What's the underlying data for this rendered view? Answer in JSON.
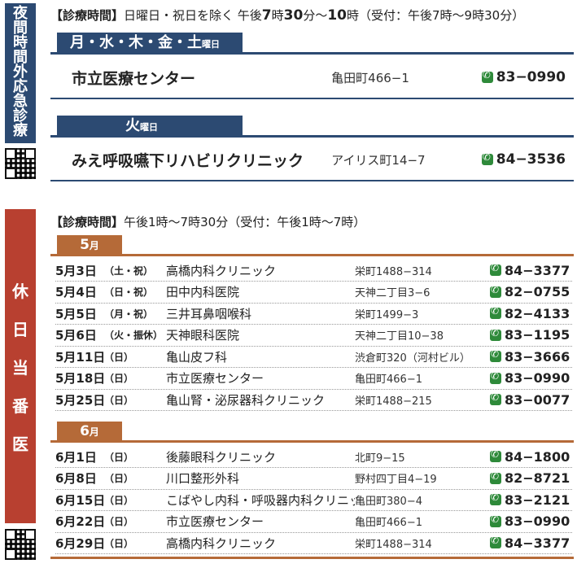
{
  "night": {
    "side_label": [
      "夜",
      "間",
      "時",
      "間",
      "外",
      "応",
      "急",
      "診",
      "療"
    ],
    "hours_label": "【診療時間】",
    "hours_text": "日曜日・祝日を除く 午後",
    "hours_big1": "7",
    "hours_text2": "時",
    "hours_big2": "30",
    "hours_text3": "分～",
    "hours_big3": "10",
    "hours_text4": "時（受付：午後7時～9時30分）",
    "groups": [
      {
        "days": "月・水・木・金・土",
        "suffix": "曜日",
        "clinic": {
          "name": "市立医療センター",
          "address": "亀田町466−1",
          "tel": "83−0990"
        }
      },
      {
        "days": "火",
        "suffix": "曜日",
        "clinic": {
          "name": "みえ呼吸嚥下リハビリクリニック",
          "address": "アイリス町14−7",
          "tel": "84−3536"
        }
      }
    ]
  },
  "holiday": {
    "side_label": [
      "休",
      "日",
      "当",
      "番",
      "医"
    ],
    "hours_label": "【診療時間】",
    "hours_text": "午後1時～7時30分（受付：午後1時～7時）",
    "months": [
      {
        "label": "5",
        "suffix": "月",
        "rows": [
          {
            "date": "5月3日",
            "dow": "（土・祝）",
            "clinic": "高橋内科クリニック",
            "address": "栄町1488−314",
            "tel": "84−3377"
          },
          {
            "date": "5月4日",
            "dow": "（日・祝）",
            "clinic": "田中内科医院",
            "address": "天神二丁目3−6",
            "tel": "82−0755"
          },
          {
            "date": "5月5日",
            "dow": "（月・祝）",
            "clinic": "三井耳鼻咽喉科",
            "address": "栄町1499−3",
            "tel": "82−4133"
          },
          {
            "date": "5月6日",
            "dow": "（火・振休）",
            "clinic": "天神眼科医院",
            "address": "天神二丁目10−38",
            "tel": "83−1195"
          },
          {
            "date": "5月11日",
            "dow": "（日）",
            "clinic": "亀山皮フ科",
            "address": "渋倉町320（河村ビル）",
            "tel": "83−3666"
          },
          {
            "date": "5月18日",
            "dow": "（日）",
            "clinic": "市立医療センター",
            "address": "亀田町466−1",
            "tel": "83−0990"
          },
          {
            "date": "5月25日",
            "dow": "（日）",
            "clinic": "亀山腎・泌尿器科クリニック",
            "address": "栄町1488−215",
            "tel": "83−0077"
          }
        ]
      },
      {
        "label": "6",
        "suffix": "月",
        "rows": [
          {
            "date": "6月1日",
            "dow": "（日）",
            "clinic": "後藤眼科クリニック",
            "address": "北町9−15",
            "tel": "84−1800"
          },
          {
            "date": "6月8日",
            "dow": "（日）",
            "clinic": "川口整形外科",
            "address": "野村四丁目4−19",
            "tel": "82−8721"
          },
          {
            "date": "6月15日",
            "dow": "（日）",
            "clinic": "こばやし内科・呼吸器内科クリニック",
            "address": "亀田町380−4",
            "tel": "83−2121"
          },
          {
            "date": "6月22日",
            "dow": "（日）",
            "clinic": "市立医療センター",
            "address": "亀田町466−1",
            "tel": "83−0990"
          },
          {
            "date": "6月29日",
            "dow": "（日）",
            "clinic": "高橋内科クリニック",
            "address": "栄町1488−314",
            "tel": "84−3377"
          }
        ]
      }
    ]
  }
}
